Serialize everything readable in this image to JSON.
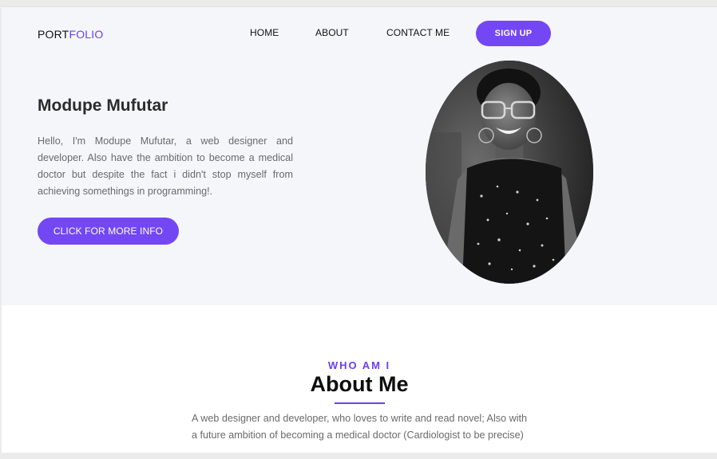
{
  "brand": {
    "logo_part1": "PORT",
    "logo_part2": "FOLIO",
    "accent_color": "#6c3ff0"
  },
  "nav": {
    "items": [
      {
        "label": "HOME"
      },
      {
        "label": "ABOUT"
      },
      {
        "label": "CONTACT ME"
      }
    ],
    "signup_label": "SIGN UP"
  },
  "hero": {
    "name": "Modupe Mufutar",
    "intro": "Hello, I'm Modupe Mufutar, a web designer and developer. Also have the ambition to become a medical doctor but despite the fact i didn't stop myself from achieving somethings in programming!.",
    "cta_label": "CLICK FOR MORE INFO",
    "portrait": "portrait-photo"
  },
  "about": {
    "eyebrow": "WHO AM I",
    "title": "About Me",
    "text": "A web designer and developer, who loves to write and read novel; Also with a future ambition of becoming a medical doctor (Cardiologist to be precise)"
  }
}
